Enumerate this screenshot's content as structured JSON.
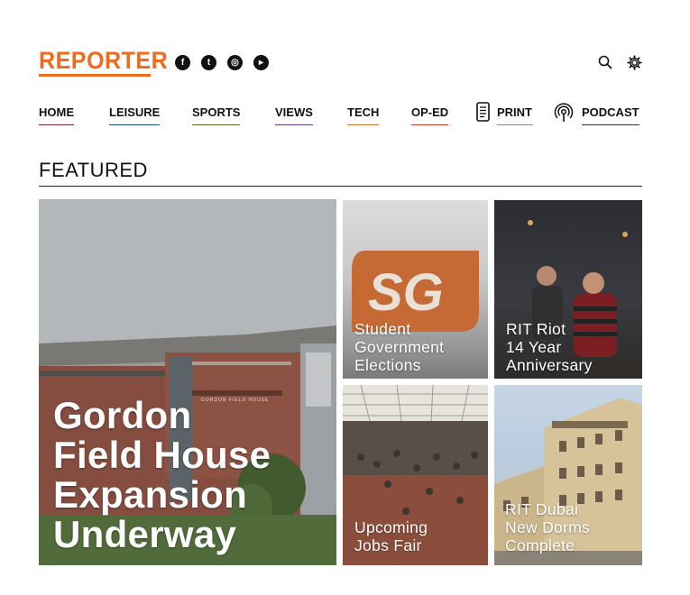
{
  "site": {
    "logo_text": "REPORTER",
    "accent": "#f26b1d"
  },
  "social": [
    {
      "icon": "facebook-icon",
      "glyph": "f"
    },
    {
      "icon": "twitter-icon",
      "glyph": "t"
    },
    {
      "icon": "instagram-icon",
      "glyph": "◎"
    },
    {
      "icon": "youtube-icon",
      "glyph": "▸"
    }
  ],
  "tools": {
    "search_icon": "search-icon",
    "settings_icon": "gear-icon"
  },
  "nav": {
    "items": [
      {
        "label": "HOME",
        "color": "#7a2a4a"
      },
      {
        "label": "LEISURE",
        "color": "#1d4e6e"
      },
      {
        "label": "SPORTS",
        "color": "#4d6b1f"
      },
      {
        "label": "VIEWS",
        "color": "#6b3b7a"
      },
      {
        "label": "TECH",
        "color": "#c87826"
      },
      {
        "label": "OP-ED",
        "color": "#c43a2e"
      },
      {
        "label": "PRINT",
        "color": "#888888"
      },
      {
        "label": "PODCAST",
        "color": "#333333"
      }
    ]
  },
  "featured": {
    "heading": "FEATURED",
    "main": {
      "title": "Gordon\nField House\nExpansion\nUnderway",
      "sign": "GORDON FIELD HOUSE"
    },
    "cards": [
      {
        "title": "Student\nGovernment\nElections",
        "logo": "SG"
      },
      {
        "title": "RIT Riot\n14 Year\nAnniversary"
      },
      {
        "title": "Upcoming\nJobs Fair"
      },
      {
        "title": "RIT Dubai\nNew Dorms\nComplete"
      }
    ]
  }
}
